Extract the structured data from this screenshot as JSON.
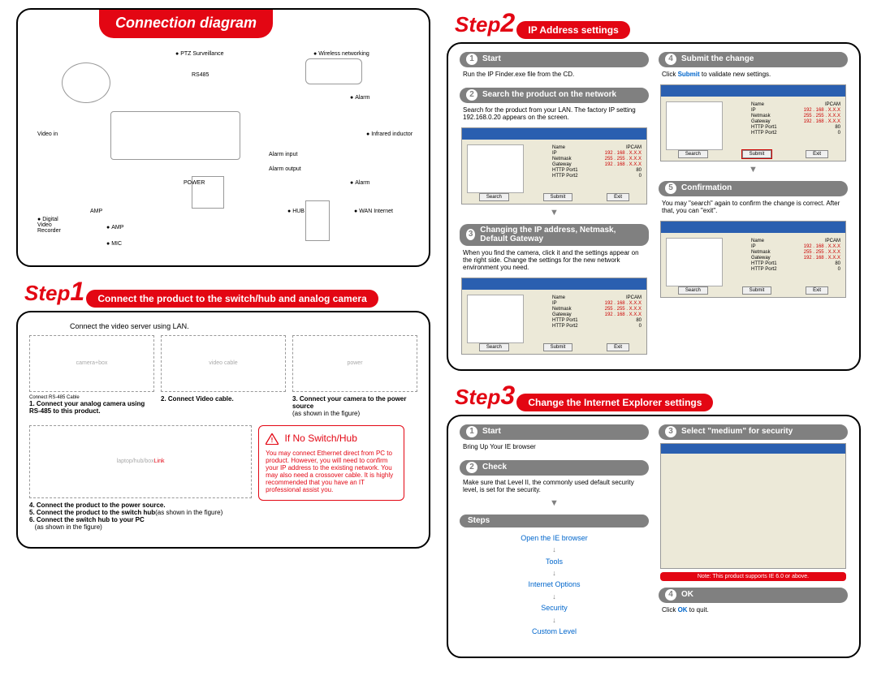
{
  "connection": {
    "title": "Connection diagram",
    "labels": {
      "ptz": "PTZ Surveillance",
      "rs485": "RS485",
      "wireless": "Wireless networking",
      "video_in": "Video in",
      "alarm": "Alarm",
      "infrared": "Infrared inductor",
      "alarm_input": "Alarm input",
      "alarm_output": "Alarm output",
      "power": "POWER",
      "hub": "HUB",
      "wan": "WAN Internet",
      "dvr": "Digital Video Recorder",
      "amp": "AMP",
      "amp2": "AMP",
      "mic": "MIC"
    }
  },
  "step1": {
    "step": "Step",
    "num": "1",
    "ribbon": "Connect the product to the switch/hub and analog camera",
    "subtitle": "Connect the video server using LAN.",
    "rs_cable": "Connect RS-485 Cable",
    "i1": {
      "n": "1.",
      "t": "Connect your analog camera using RS-485 to this product."
    },
    "i2": {
      "n": "2.",
      "t": "Connect Video cable."
    },
    "i3": {
      "n": "3.",
      "t": "Connect your camera to the power source",
      "s": "(as shown in the figure)"
    },
    "i4": {
      "n": "4.",
      "t": "Connect the product to the power source."
    },
    "i5": {
      "n": "5.",
      "t": "Connect the product to the switch hub",
      "s": "(as shown in the figure)"
    },
    "i6": {
      "n": "6.",
      "t": "Connect the switch hub to your PC",
      "s": "(as shown in the figure)"
    },
    "link": "Link",
    "warn": {
      "title": "If No Switch/Hub",
      "body": "You may connect Ethernet direct from PC to product.  However, you will need to confirm your IP address to the existing network. You may also need a crossover cable. It is highly recommended that you have an IT professional assist  you."
    }
  },
  "step2": {
    "step": "Step",
    "num": "2",
    "ribbon": "IP Address settings",
    "s1": {
      "n": "1",
      "t": "Start",
      "b": "Run the IP Finder.exe file from the CD."
    },
    "s2": {
      "n": "2",
      "t": "Search the product on the network",
      "b": "Search for the product from your LAN. The factory IP setting 192.168.0.20 appears on the screen."
    },
    "s3": {
      "n": "3",
      "t": "Changing the IP address, Netmask, Default Gateway",
      "b": "When you find the camera, click it and the settings appear on the right side. Change the settings for the new network environment you need."
    },
    "s4": {
      "n": "4",
      "t": "Submit the change",
      "b": "Click Submit to validate new settings."
    },
    "s5": {
      "n": "5",
      "t": "Confirmation",
      "b": "You may \"search\" again to confirm the change is correct. After that, you can \"exit\"."
    },
    "form": {
      "name": "Name",
      "name_v": "IPCAM",
      "ip": "IP",
      "ip_v": "192 . 168 . X.X.X",
      "netmask": "Netmask",
      "netmask_v": "255 . 255 . X.X.X",
      "gateway": "Gateway",
      "gateway_v": "192 . 168 . X.X.X",
      "http1": "HTTP Port1",
      "http1_v": "80",
      "http2": "HTTP Port2",
      "http2_v": "0"
    },
    "btns": {
      "search": "Search",
      "submit": "Submit",
      "exit": "Exit"
    }
  },
  "step3": {
    "step": "Step",
    "num": "3",
    "ribbon": "Change the Internet Explorer settings",
    "s1": {
      "n": "1",
      "t": "Start",
      "b": "Bring Up Your IE browser"
    },
    "s2": {
      "n": "2",
      "t": "Check",
      "b": "Make sure that Level II, the commonly used default security level, is set for the security."
    },
    "steps_title": "Steps",
    "steps": {
      "a": "Open the IE browser",
      "b": "Tools",
      "c": "Internet Options",
      "d": "Security",
      "e": "Custom Level"
    },
    "s3": {
      "n": "3",
      "t": "Select \"medium\" for security"
    },
    "note": "Note: This product supports IE 6.0 or above.",
    "s4": {
      "n": "4",
      "t": "OK",
      "b": "Click OK to quit."
    }
  }
}
